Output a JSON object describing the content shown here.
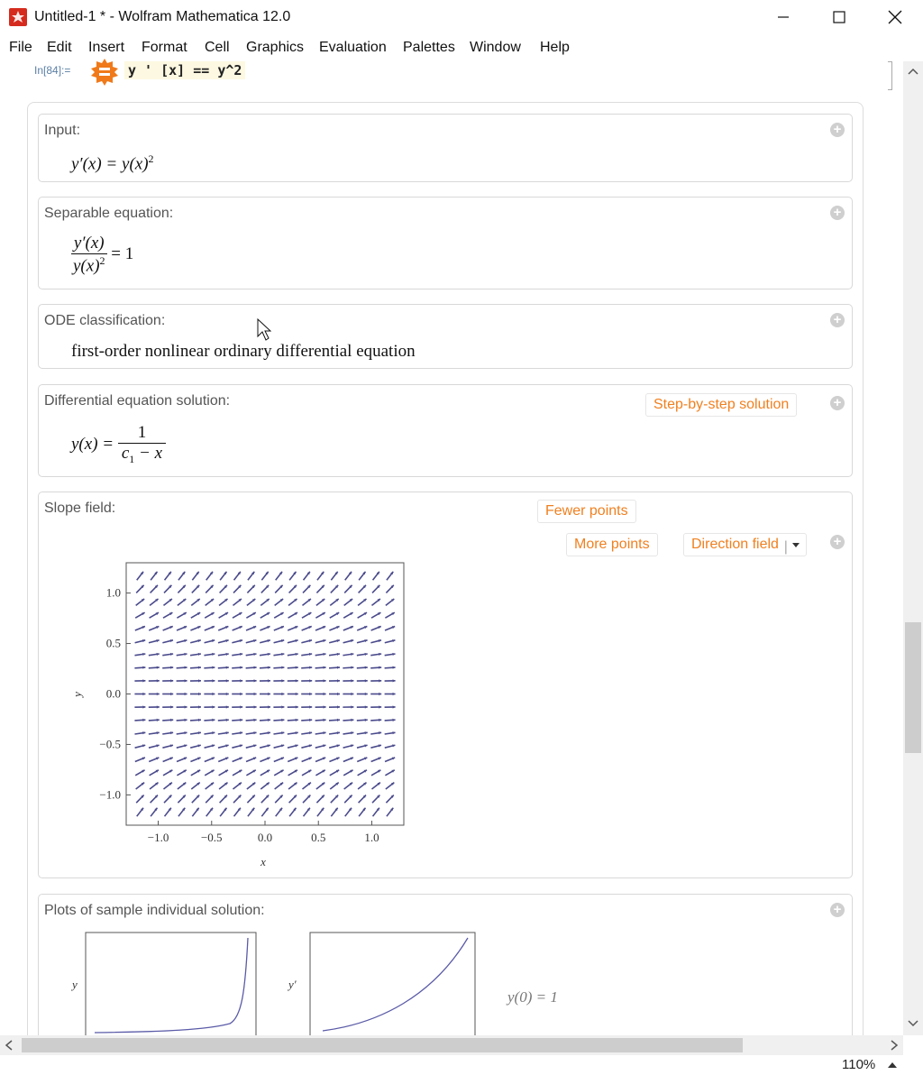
{
  "window": {
    "title": "Untitled-1 * - Wolfram Mathematica 12.0",
    "controls": {
      "minimize": "—",
      "maximize": "☐",
      "close": "✕"
    }
  },
  "menu": [
    "File",
    "Edit",
    "Insert",
    "Format",
    "Cell",
    "Graphics",
    "Evaluation",
    "Palettes",
    "Window",
    "Help"
  ],
  "input_cell": {
    "label": "In[84]:=",
    "code": "y ' [x]  == y^2"
  },
  "pods": {
    "input": {
      "title": "Input:"
    },
    "separable": {
      "title": "Separable equation:",
      "rhs": "= 1"
    },
    "classification": {
      "title": "ODE classification:",
      "text": "first-order nonlinear ordinary differential equation"
    },
    "solution": {
      "title": "Differential equation solution:",
      "button": "Step-by-step solution"
    },
    "slope": {
      "title": "Slope field:",
      "buttons": {
        "fewer": "Fewer points",
        "more": "More points",
        "direction": "Direction field"
      }
    },
    "sample": {
      "title": "Plots of sample individual solution:",
      "y_label": "y",
      "yp_label": "y′",
      "condition": "y(0) = 1"
    }
  },
  "chart_data": {
    "type": "scatter",
    "title": "",
    "xlabel": "x",
    "ylabel": "y",
    "xlim": [
      -1.3,
      1.3
    ],
    "ylim": [
      -1.3,
      1.3
    ],
    "x_ticks": [
      "−1.0",
      "−0.5",
      "0.0",
      "0.5",
      "1.0"
    ],
    "y_ticks": [
      "1.0",
      "0.5",
      "0.0",
      "−0.5",
      "−1.0"
    ],
    "field": "dy/dx = y^2",
    "grid_count": 19,
    "arrow_color": "#4a4a8c"
  },
  "zoom": "110%",
  "colors": {
    "accent": "#f08020",
    "brand": "#d52b1e"
  }
}
